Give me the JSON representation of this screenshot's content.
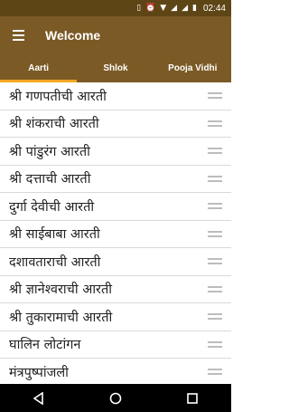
{
  "status_bar": {
    "time": "02:44",
    "icons": [
      "notification-icon",
      "vibrate-icon",
      "alarm-icon",
      "wifi-icon",
      "signal-icon",
      "signal-icon",
      "battery-icon"
    ]
  },
  "app_bar": {
    "title": "Welcome",
    "menu_icon": "hamburger-menu-icon"
  },
  "tabs": [
    {
      "label": "Aarti",
      "active": true
    },
    {
      "label": "Shlok",
      "active": false
    },
    {
      "label": "Pooja Vidhi",
      "active": false
    }
  ],
  "list": {
    "items": [
      "श्री गणपतीची आरती",
      "श्री शंकराची आरती",
      "श्री पांडुरंग आरती",
      "श्री दत्ताची आरती",
      "दुर्गा देवीची आरती",
      "श्री साईबाबा आरती",
      "दशावताराची आरती",
      "श्री ज्ञानेश्वराची आरती",
      "श्री तुकारामाची आरती",
      "घालिन लोटांगन",
      "मंत्रपुष्पांजली"
    ]
  },
  "nav_bar": {
    "back_icon": "back-triangle-icon",
    "home_icon": "home-circle-icon",
    "recents_icon": "recents-square-icon"
  }
}
